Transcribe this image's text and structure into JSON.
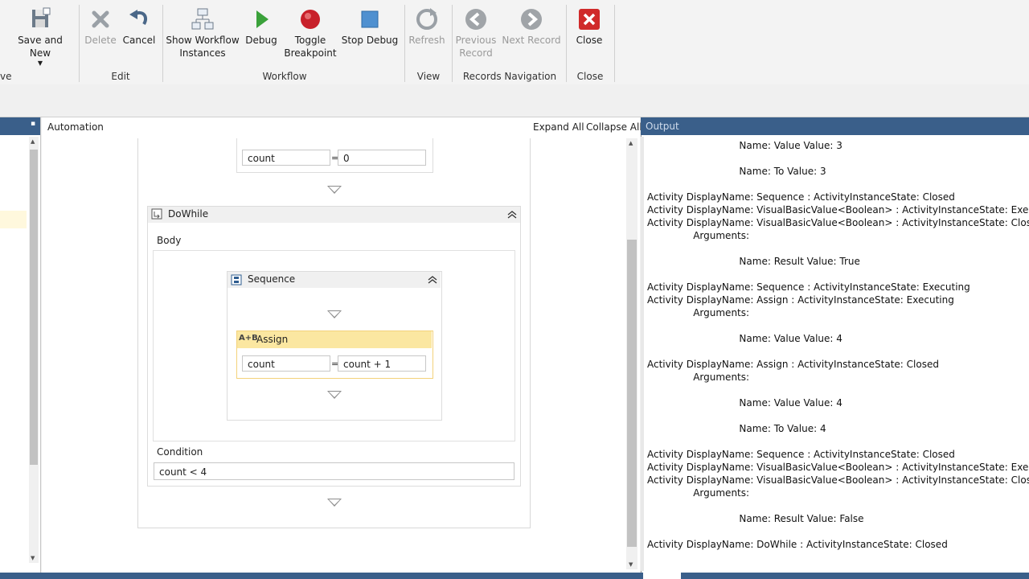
{
  "ribbon": {
    "groups": {
      "save_partial": "ve",
      "edit": "Edit",
      "workflow": "Workflow",
      "view": "View",
      "records_navigation": "Records Navigation",
      "close": "Close"
    },
    "buttons": {
      "save_and_new": "Save and New",
      "delete": "Delete",
      "cancel": "Cancel",
      "show_workflow_instances_1": "Show Workflow",
      "show_workflow_instances_2": "Instances",
      "debug": "Debug",
      "toggle_breakpoint_1": "Toggle",
      "toggle_breakpoint_2": "Breakpoint",
      "stop_debug": "Stop Debug",
      "refresh": "Refresh",
      "previous_record_1": "Previous",
      "previous_record_2": "Record",
      "next_record": "Next Record",
      "close": "Close"
    }
  },
  "designer": {
    "title": "Automation",
    "expand_all": "Expand All",
    "collapse_all": "Collapse All",
    "top_assign": {
      "to": "count",
      "eq": "=",
      "value": "0"
    },
    "dowhile": {
      "title": "DoWhile",
      "body_label": "Body",
      "sequence": {
        "title": "Sequence",
        "assign": {
          "title": "Assign",
          "to": "count",
          "eq": "=",
          "value": "count + 1"
        }
      },
      "condition_label": "Condition",
      "condition_value": "count < 4"
    }
  },
  "output": {
    "title": "Output",
    "lines": [
      "                              Name: Value Value: 3",
      "",
      "                              Name: To Value: 3",
      "",
      "Activity DisplayName: Sequence : ActivityInstanceState: Closed",
      "Activity DisplayName: VisualBasicValue<Boolean> : ActivityInstanceState: Executing",
      "Activity DisplayName: VisualBasicValue<Boolean> : ActivityInstanceState: Closed",
      "               Arguments:",
      "",
      "                              Name: Result Value: True",
      "",
      "Activity DisplayName: Sequence : ActivityInstanceState: Executing",
      "Activity DisplayName: Assign : ActivityInstanceState: Executing",
      "               Arguments:",
      "",
      "                              Name: Value Value: 4",
      "",
      "Activity DisplayName: Assign : ActivityInstanceState: Closed",
      "               Arguments:",
      "",
      "                              Name: Value Value: 4",
      "",
      "                              Name: To Value: 4",
      "",
      "Activity DisplayName: Sequence : ActivityInstanceState: Closed",
      "Activity DisplayName: VisualBasicValue<Boolean> : ActivityInstanceState: Executing",
      "Activity DisplayName: VisualBasicValue<Boolean> : ActivityInstanceState: Closed",
      "               Arguments:",
      "",
      "                              Name: Result Value: False",
      "",
      "Activity DisplayName: DoWhile : ActivityInstanceState: Closed"
    ]
  },
  "colors": {
    "panel_header": "#3a5f8a",
    "assign_header": "#fbe7a1",
    "assign_border": "#f3d27a"
  }
}
